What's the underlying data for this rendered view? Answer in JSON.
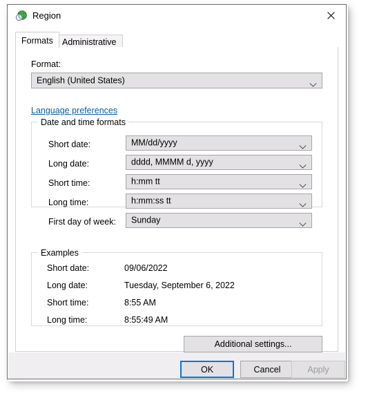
{
  "window": {
    "title": "Region",
    "icon": "region-globe-clock-icon",
    "close_label": "✕"
  },
  "tabs": [
    {
      "id": "formats",
      "label": "Formats",
      "active": true
    },
    {
      "id": "administrative",
      "label": "Administrative",
      "active": false
    }
  ],
  "format_section": {
    "label": "Format:",
    "value": "English (United States)",
    "link": "Language preferences"
  },
  "date_time_group": {
    "legend": "Date and time formats",
    "rows": [
      {
        "label": "Short date:",
        "value": "MM/dd/yyyy"
      },
      {
        "label": "Long date:",
        "value": "dddd, MMMM d, yyyy"
      },
      {
        "label": "Short time:",
        "value": "h:mm tt"
      },
      {
        "label": "Long time:",
        "value": "h:mm:ss tt"
      },
      {
        "label": "First day of week:",
        "value": "Sunday"
      }
    ]
  },
  "examples_group": {
    "legend": "Examples",
    "rows": [
      {
        "label": "Short date:",
        "value": "09/06/2022"
      },
      {
        "label": "Long date:",
        "value": "Tuesday, September 6, 2022"
      },
      {
        "label": "Short time:",
        "value": "8:55 AM"
      },
      {
        "label": "Long time:",
        "value": "8:55:49 AM"
      }
    ]
  },
  "buttons": {
    "additional_settings": "Additional settings...",
    "ok": "OK",
    "cancel": "Cancel",
    "apply": "Apply"
  },
  "colors": {
    "accent": "#0078d7",
    "link": "#0a5fa8",
    "control_face": "#e3e1e4",
    "footer": "#f0eef0"
  }
}
